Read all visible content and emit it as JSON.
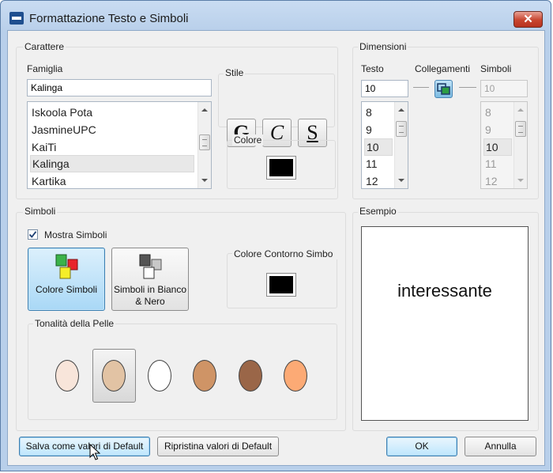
{
  "window": {
    "title": "Formattazione Testo e Simboli",
    "close_glyph": "✕"
  },
  "carattere": {
    "group_label": "Carattere",
    "famiglia_label": "Famiglia",
    "famiglia_value": "Kalinga",
    "font_list": [
      "Iskoola Pota",
      "JasmineUPC",
      "KaiTi",
      "Kalinga",
      "Kartika"
    ],
    "selected_font": "Kalinga",
    "stile_label": "Stile",
    "bold_label": "G",
    "italic_label": "C",
    "underline_label": "S",
    "colore_label": "Colore",
    "colore_value": "#000000"
  },
  "dimensioni": {
    "group_label": "Dimensioni",
    "testo_label": "Testo",
    "collegamenti_label": "Collegamenti",
    "simboli_label": "Simboli",
    "testo_value": "10",
    "simboli_value": "10",
    "testo_sizes": [
      "8",
      "9",
      "10",
      "11",
      "12"
    ],
    "simboli_sizes": [
      "8",
      "9",
      "10",
      "11",
      "12"
    ],
    "selected_size": "10"
  },
  "simboli": {
    "group_label": "Simboli",
    "mostra_label": "Mostra Simboli",
    "mostra_checked": true,
    "colore_button_label": "Colore Simboli",
    "bw_button_label": "Simboli in Bianco & Nero",
    "contorno_label": "Colore Contorno Simbo",
    "contorno_value": "#000000",
    "tonalita_label": "Tonalità della Pelle",
    "skin_tones": [
      "#f8e5da",
      "#e2c3a4",
      "#ffffff",
      "#cf9466",
      "#9a6648",
      "#fcaa75"
    ],
    "selected_skin_index": 1
  },
  "esempio": {
    "group_label": "Esempio",
    "preview_text": "interessante"
  },
  "footer": {
    "save_default_label": "Salva come valori di Default",
    "restore_default_label": "Ripristina valori di Default",
    "ok_label": "OK",
    "cancel_label": "Annulla"
  }
}
